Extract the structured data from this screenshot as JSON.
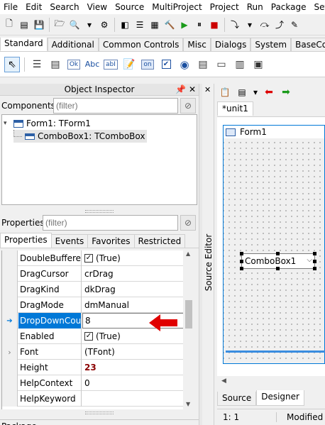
{
  "menu": [
    "File",
    "Edit",
    "Search",
    "View",
    "Source",
    "MultiProject",
    "Project",
    "Run",
    "Package",
    "Settin"
  ],
  "palette_tabs": [
    "Standard",
    "Additional",
    "Common Controls",
    "Misc",
    "Dialogs",
    "System",
    "BaseControl"
  ],
  "palette_tab_active": "Standard",
  "palette_captions": {
    "ok": "Ok",
    "abc": "Abc",
    "abi": "abI",
    "on": "on"
  },
  "object_inspector": {
    "title": "Object Inspector",
    "components_label": "Components",
    "components_filter_placeholder": "(filter)",
    "tree": [
      "Form1: TForm1",
      "ComboBox1: TComboBox"
    ],
    "properties_label": "Properties",
    "properties_filter_placeholder": "(filter)",
    "tabs": [
      "Properties",
      "Events",
      "Favorites",
      "Restricted"
    ],
    "rows": [
      {
        "name": "DoubleBuffered",
        "value": "(True)",
        "checkbox": true
      },
      {
        "name": "DragCursor",
        "value": "crDrag"
      },
      {
        "name": "DragKind",
        "value": "dkDrag"
      },
      {
        "name": "DragMode",
        "value": "dmManual"
      },
      {
        "name": "DropDownCour",
        "value": "8",
        "selected": true
      },
      {
        "name": "Enabled",
        "value": "(True)",
        "checkbox": true
      },
      {
        "name": "Font",
        "value": "(TFont)",
        "expandable": true
      },
      {
        "name": "Height",
        "value": "23",
        "bold": true
      },
      {
        "name": "HelpContext",
        "value": "0"
      },
      {
        "name": "HelpKeyword",
        "value": ""
      }
    ]
  },
  "package_label": "Package",
  "source_editor_label": "Source Editor",
  "editor": {
    "unit_tab": "*unit1",
    "form_caption": "Form1",
    "combo_text": "ComboBox1",
    "bottom_tabs": [
      "Source",
      "Designer"
    ],
    "active_bottom_tab": "Designer",
    "status_pos": "1:  1",
    "status_modified": "Modified"
  },
  "colors": {
    "selection": "#0078d7",
    "arrow": "#e00000",
    "height_value": "#8b0000"
  }
}
